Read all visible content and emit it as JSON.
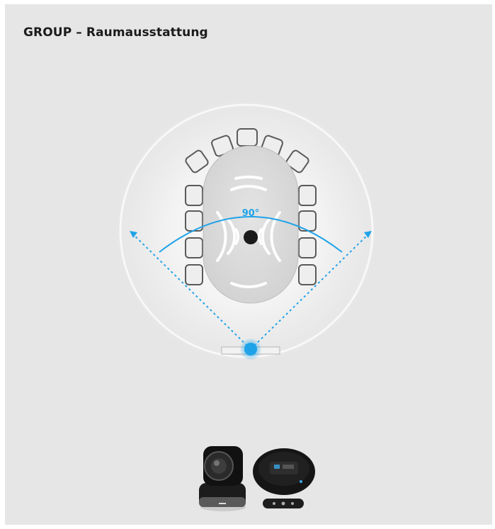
{
  "header": {
    "title": "GROUP – Raumausstattung"
  },
  "diagram": {
    "angle_label": "90°",
    "colors": {
      "background": "#e6e6e6",
      "coverage_glow": "#ffffff",
      "table": "#d8d8d8",
      "chair_stroke": "#5a5a5a",
      "accent_blue": "#1fa3e8",
      "speakerphone": "#1a1a1a"
    }
  },
  "products": {
    "items": [
      "camera-icon",
      "speakerphone-hub-icon",
      "remote-icon"
    ]
  }
}
